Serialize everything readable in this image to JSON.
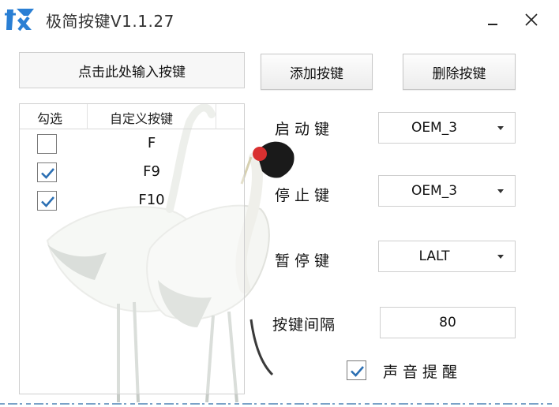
{
  "window": {
    "title": "极简按键V1.1.27",
    "accent_color": "#2a7fd4",
    "check_color": "#2b6fb3"
  },
  "toolbar": {
    "input_key_label": "点击此处输入按键",
    "add_key_label": "添加按键",
    "delete_key_label": "删除按键"
  },
  "key_list": {
    "columns": [
      "勾选",
      "自定义按键"
    ],
    "rows": [
      {
        "checked": false,
        "key": "F"
      },
      {
        "checked": true,
        "key": "F9"
      },
      {
        "checked": true,
        "key": "F10"
      }
    ]
  },
  "settings": {
    "start_key": {
      "label": "启动键",
      "value": "OEM_3"
    },
    "stop_key": {
      "label": "停止键",
      "value": "OEM_3"
    },
    "pause_key": {
      "label": "暂停键",
      "value": "LALT"
    },
    "interval": {
      "label": "按键间隔",
      "value": "80"
    },
    "sound_alert": {
      "label": "声音提醒",
      "checked": true
    }
  },
  "icons": {
    "logo": "app-logo-icon",
    "minimize": "minimize-icon",
    "close": "close-icon",
    "dropdown": "chevron-down-icon",
    "check": "check-icon"
  }
}
